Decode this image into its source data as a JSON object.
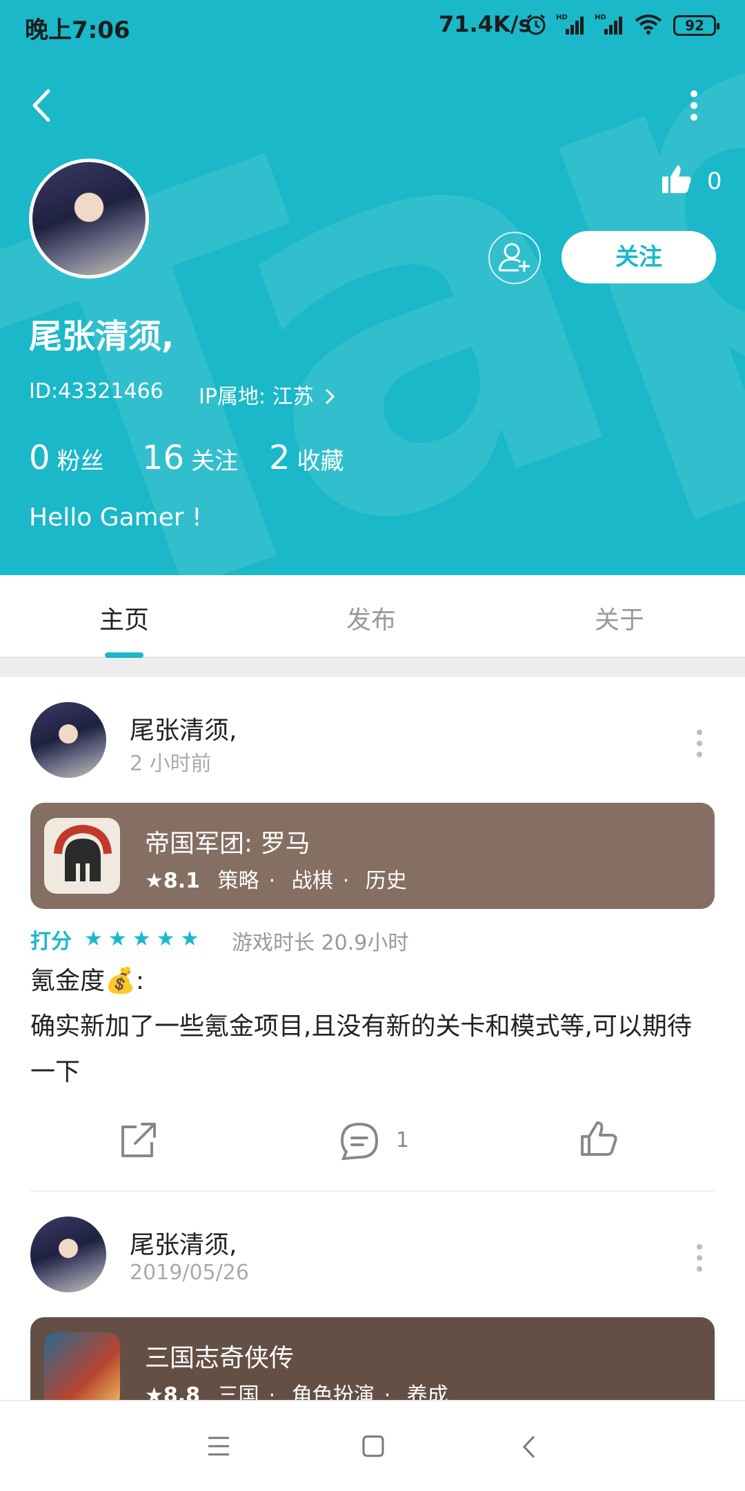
{
  "status": {
    "time": "晚上7:06",
    "speed": "71.4K/s",
    "battery": "92"
  },
  "profile": {
    "name": "尾张清须,",
    "id_text": "ID:43321466",
    "ip_text": "IP属地: 江苏",
    "bio": "Hello Gamer !",
    "likes": "0",
    "follow_label": "关注",
    "stats": [
      {
        "num": "0",
        "label": "粉丝"
      },
      {
        "num": "16",
        "label": "关注"
      },
      {
        "num": "2",
        "label": "收藏"
      }
    ]
  },
  "tabs": [
    {
      "label": "主页"
    },
    {
      "label": "发布"
    },
    {
      "label": "关于"
    }
  ],
  "posts": [
    {
      "author": "尾张清须,",
      "time": "2 小时前",
      "game": {
        "title": "帝国军团: 罗马",
        "score": "8.1",
        "tags": [
          "策略",
          "战棋",
          "历史"
        ],
        "color": "#856e62"
      },
      "rating_label": "打分",
      "stars": "★★★★★",
      "playtime": "游戏时长 20.9小时",
      "text_line1": "氪金度💰:",
      "text_line2": "确实新加了一些氪金项目,且没有新的关卡和模式等,可以期待一下",
      "comments": "1"
    },
    {
      "author": "尾张清须,",
      "time": "2019/05/26",
      "game": {
        "title": "三国志奇侠传",
        "score": "8.8",
        "tags": [
          "三国",
          "角色扮演",
          "养成"
        ],
        "color": "#644f45"
      }
    }
  ]
}
